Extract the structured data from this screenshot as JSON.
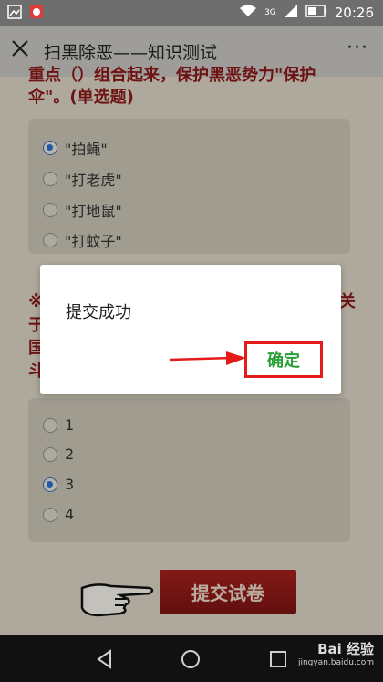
{
  "status_bar": {
    "signal": "3G",
    "time": "20:26"
  },
  "header": {
    "title": "扫黑除恶——知识测试",
    "more": "···"
  },
  "question1": {
    "text_line1": "重点（）组合起来，保护黑恶势力\"保护",
    "text_line2": "伞\"。(单选题)",
    "options": [
      "\"拍蝇\"",
      "\"打老虎\"",
      "\"打地鼠\"",
      "\"打蚊子\""
    ],
    "selected": 0
  },
  "question2": {
    "text_lines": [
      "※",
      "于",
      "国",
      "斗"
    ],
    "text_right": "关",
    "options": [
      "1",
      "2",
      "3",
      "4"
    ],
    "selected": 2
  },
  "submit": {
    "label": "提交试卷"
  },
  "dialog": {
    "message": "提交成功",
    "confirm": "确定"
  },
  "watermark": {
    "brand": "Bai 经验",
    "sub": "jingyan.baidu.com"
  },
  "colors": {
    "accent_red": "#e31b1b",
    "confirm_green": "#2aa037",
    "question_red": "#8a1818"
  }
}
